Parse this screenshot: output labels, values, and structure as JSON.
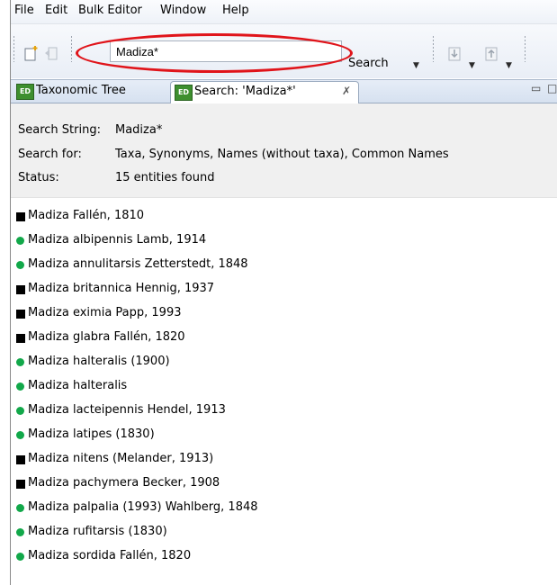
{
  "menu": {
    "items": [
      {
        "label": "File"
      },
      {
        "label": "Edit"
      },
      {
        "label": "Bulk Editor"
      },
      {
        "label": "Window"
      },
      {
        "label": "Help"
      }
    ]
  },
  "toolbar": {
    "search_value": "Madiza*",
    "search_label": "Search",
    "icons": [
      "new-taxon-icon",
      "back-icon",
      "import-icon",
      "export-icon"
    ]
  },
  "tabs": [
    {
      "label": "Taxonomic Tree",
      "icon_text": "ED",
      "active": false
    },
    {
      "label": "Search: 'Madiza*'",
      "icon_text": "ED",
      "active": true,
      "close": "✗"
    }
  ],
  "search_info": {
    "string_label": "Search String:",
    "string_value": "Madiza*",
    "for_label": "Search for:",
    "for_value": "Taxa, Synonyms, Names (without taxa), Common Names",
    "status_label": "Status:",
    "status_value": "15 entities found"
  },
  "results": [
    {
      "type": "accepted",
      "name": "Madiza Fallén, 1810"
    },
    {
      "type": "synonym",
      "name": "Madiza albipennis Lamb, 1914"
    },
    {
      "type": "synonym",
      "name": "Madiza annulitarsis Zetterstedt, 1848"
    },
    {
      "type": "accepted",
      "name": "Madiza britannica Hennig, 1937"
    },
    {
      "type": "accepted",
      "name": "Madiza eximia Papp, 1993"
    },
    {
      "type": "accepted",
      "name": "Madiza glabra Fallén, 1820"
    },
    {
      "type": "synonym",
      "name": "Madiza halteralis (1900)"
    },
    {
      "type": "synonym",
      "name": "Madiza halteralis"
    },
    {
      "type": "synonym",
      "name": "Madiza lacteipennis Hendel, 1913"
    },
    {
      "type": "synonym",
      "name": "Madiza latipes (1830)"
    },
    {
      "type": "accepted",
      "name": "Madiza nitens (Melander, 1913)"
    },
    {
      "type": "accepted",
      "name": "Madiza pachymera Becker, 1908"
    },
    {
      "type": "synonym",
      "name": "Madiza palpalia (1993) Wahlberg, 1848"
    },
    {
      "type": "synonym",
      "name": "Madiza rufitarsis (1830)"
    },
    {
      "type": "synonym",
      "name": "Madiza sordida Fallén, 1820"
    }
  ],
  "colors": {
    "accepted_marker": "#000000",
    "synonym_marker": "#12a84a",
    "highlight": "#e0141a"
  }
}
